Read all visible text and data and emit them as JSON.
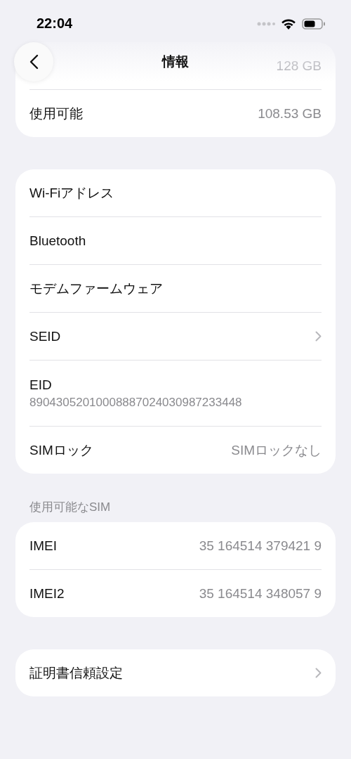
{
  "status_bar": {
    "time": "22:04"
  },
  "nav": {
    "title": "情報"
  },
  "groups": [
    {
      "rows": [
        {
          "kind": "value",
          "label": "",
          "value": "128 GB",
          "faded": true
        },
        {
          "kind": "value",
          "label": "使用可能",
          "value": "108.53 GB",
          "faded": false
        }
      ]
    },
    {
      "rows": [
        {
          "kind": "plain",
          "label": "Wi-Fiアドレス"
        },
        {
          "kind": "plain",
          "label": "Bluetooth"
        },
        {
          "kind": "plain",
          "label": "モデムファームウェア"
        },
        {
          "kind": "chevron",
          "label": "SEID"
        },
        {
          "kind": "subtitle",
          "label": "EID",
          "value": "89043052010008887024030987233448"
        },
        {
          "kind": "value",
          "label": "SIMロック",
          "value": "SIMロックなし",
          "faded": false
        }
      ]
    },
    {
      "header": "使用可能なSIM",
      "rows": [
        {
          "kind": "value",
          "label": "IMEI",
          "value": "35 164514 379421 9",
          "faded": false
        },
        {
          "kind": "value",
          "label": "IMEI2",
          "value": "35 164514 348057 9",
          "faded": false
        }
      ]
    },
    {
      "rows": [
        {
          "kind": "chevron",
          "label": "証明書信頼設定"
        }
      ]
    }
  ]
}
